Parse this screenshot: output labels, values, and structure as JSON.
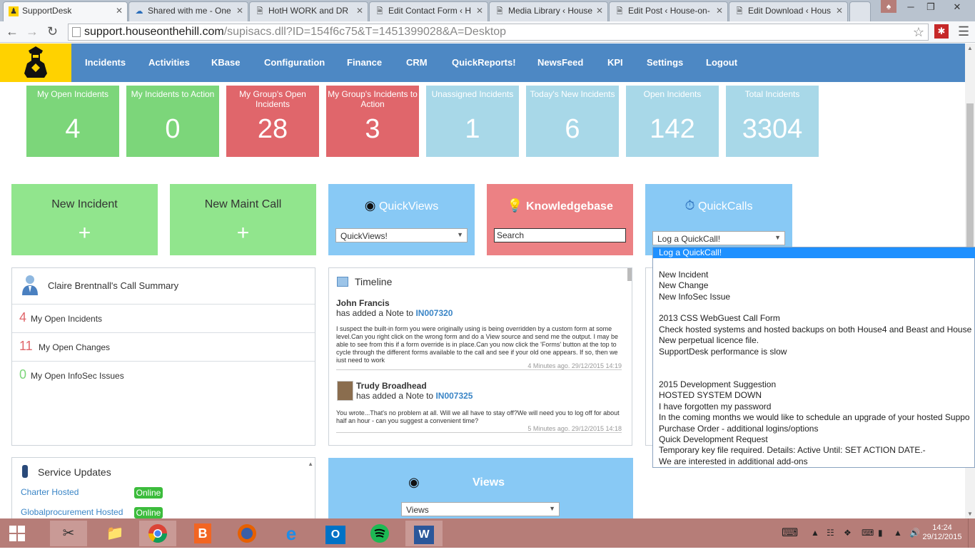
{
  "tabs": [
    {
      "label": "SupportDesk",
      "icon": "supportdesk-icon",
      "active": true
    },
    {
      "label": "Shared with me - One",
      "icon": "cloud-icon"
    },
    {
      "label": "HotH WORK and DR",
      "icon": "doc-icon"
    },
    {
      "label": "Edit Contact Form ‹ H",
      "icon": "doc-icon"
    },
    {
      "label": "Media Library ‹ House",
      "icon": "doc-icon"
    },
    {
      "label": "Edit Post ‹ House-on-",
      "icon": "doc-icon"
    },
    {
      "label": "Edit Download ‹ Hous",
      "icon": "doc-icon"
    }
  ],
  "address": {
    "host": "support.houseonthehill.com",
    "path": "/supisacs.dll?ID=154f6c75&T=1451399028&A=Desktop"
  },
  "nav": [
    "Incidents",
    "Activities",
    "KBase",
    "Configuration",
    "Finance",
    "CRM",
    "QuickReports!",
    "NewsFeed",
    "KPI",
    "Settings",
    "Logout"
  ],
  "stats": [
    {
      "label": "My Open Incidents",
      "value": "4",
      "color": "#7cd67a"
    },
    {
      "label": "My Incidents to Action",
      "value": "0",
      "color": "#7cd67a"
    },
    {
      "label": "My Group's Open Incidents",
      "value": "28",
      "color": "#e0666b"
    },
    {
      "label": "My Group's Incidents to Action",
      "value": "3",
      "color": "#e0666b"
    },
    {
      "label": "Unassigned Incidents",
      "value": "1",
      "color": "#a8d8e8"
    },
    {
      "label": "Today's New Incidents",
      "value": "6",
      "color": "#a8d8e8"
    },
    {
      "label": "Open Incidents",
      "value": "142",
      "color": "#a8d8e8"
    },
    {
      "label": "Total Incidents",
      "value": "3304",
      "color": "#a8d8e8"
    }
  ],
  "cards": {
    "new_incident": {
      "title": "New Incident",
      "plus": "+"
    },
    "new_maint": {
      "title": "New Maint Call",
      "plus": "+"
    },
    "quickviews": {
      "title": "QuickViews",
      "select": "QuickViews!"
    },
    "knowledgebase": {
      "title": "Knowledgebase",
      "search_value": "Search"
    },
    "quickcalls": {
      "title": "QuickCalls",
      "select": "Log a QuickCall!"
    }
  },
  "summary": {
    "title": "Claire Brentnall's Call Summary",
    "rows": [
      {
        "count": "4",
        "label": "My Open Incidents",
        "color": "#e0666b"
      },
      {
        "count": "11",
        "label": "My Open Changes",
        "color": "#e0666b"
      },
      {
        "count": "0",
        "label": "My Open InfoSec Issues",
        "color": "#7cd67a"
      }
    ]
  },
  "timeline": {
    "title": "Timeline",
    "entries": [
      {
        "name": "John Francis",
        "action": "has added a Note to",
        "ref": "IN007320",
        "body": "I suspect the built-in form you were originally using is being overridden by a custom form at some level.Can you right click on the wrong form and do a View source and send me the output. I may be able to see from this if a form override is in place.Can you now click the 'Forms' button at the top to cycle through the different forms available to the call and see if your old one appears. If so, then we just need to work",
        "time": "4 Minutes ago. 29/12/2015 14:19"
      },
      {
        "name": "Trudy Broadhead",
        "action": "has added a Note to",
        "ref": "IN007325",
        "body": "You wrote...That's no problem at all. Will we all have to stay off?We will need you to log off for about half an hour - can you suggest a convenient time?",
        "time": "5 Minutes ago. 29/12/2015 14:18"
      }
    ]
  },
  "service": {
    "title": "Service Updates",
    "rows": [
      {
        "name": "Charter Hosted",
        "status": "Online"
      },
      {
        "name": "Globalprocurement Hosted",
        "status": "Online"
      }
    ]
  },
  "views": {
    "title": "Views",
    "select": "Views"
  },
  "quickcall_options": [
    {
      "label": "Log a QuickCall!",
      "selected": true
    },
    {
      "label": ""
    },
    {
      "label": "New Incident"
    },
    {
      "label": "New Change"
    },
    {
      "label": "New InfoSec Issue"
    },
    {
      "label": ""
    },
    {
      "label": "2013 CSS WebGuest Call Form"
    },
    {
      "label": "Check hosted systems and hosted backups on both House4 and Beast and House"
    },
    {
      "label": "New perpetual licence file."
    },
    {
      "label": "SupportDesk performance is slow"
    },
    {
      "label": ""
    },
    {
      "label": ""
    },
    {
      "label": "2015 Development Suggestion"
    },
    {
      "label": "HOSTED SYSTEM DOWN"
    },
    {
      "label": "I have forgotten my password"
    },
    {
      "label": "In the coming months we would like to schedule an upgrade of your hosted Suppo"
    },
    {
      "label": "Purchase Order - additional logins/options"
    },
    {
      "label": "Quick Development Request"
    },
    {
      "label": "Temporary key file required. Details: Active Until: SET ACTION DATE.-"
    },
    {
      "label": "We are interested in additional add-ons"
    }
  ],
  "taskbar": {
    "time": "14:24",
    "date": "29/12/2015"
  }
}
